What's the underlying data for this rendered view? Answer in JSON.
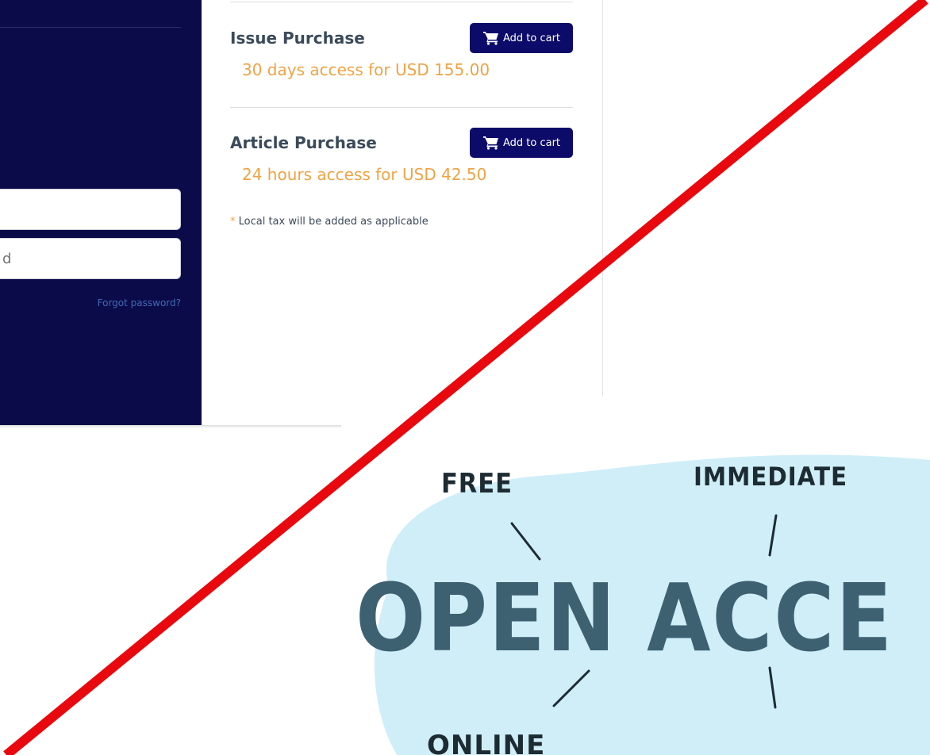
{
  "login": {
    "username_placeholder": "",
    "password_placeholder": "d",
    "forgot_link": "Forgot password?"
  },
  "purchase": {
    "issue": {
      "title": "Issue Purchase",
      "price": "30 days access for USD 155.00",
      "button": "Add to cart"
    },
    "article": {
      "title": "Article Purchase",
      "price": "24 hours access for USD 42.50",
      "button": "Add to cart"
    },
    "tax_star": "*",
    "tax_note": " Local tax will be added as applicable"
  },
  "illustration": {
    "free": "FREE",
    "immediate": "IMMEDIATE",
    "title": "OPEN ACCE",
    "online": "ONLINE"
  },
  "colors": {
    "navy": "#0c0b4a",
    "button": "#0c0b6a",
    "price_orange": "#f0a345",
    "slash_red": "#e8080e",
    "cloud_blue": "#cfeef8"
  },
  "icons": {
    "cart": "shopping-cart-icon"
  }
}
